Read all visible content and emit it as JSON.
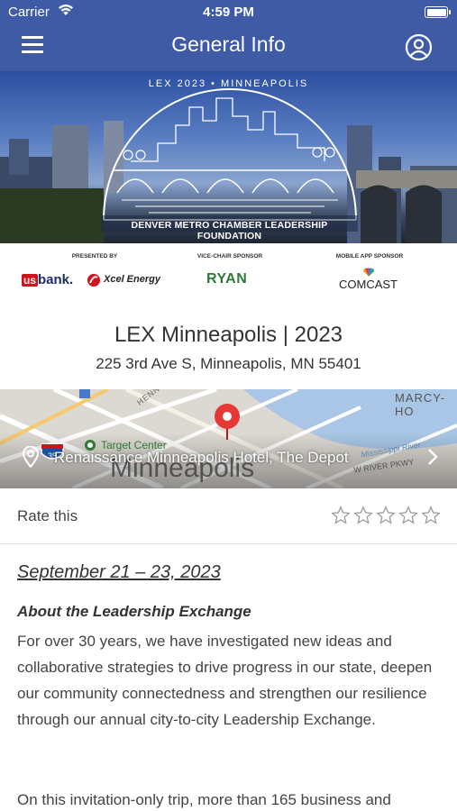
{
  "status_bar": {
    "carrier": "Carrier",
    "time": "4:59 PM"
  },
  "nav": {
    "title": "General Info"
  },
  "banner": {
    "arc_text": "LEX 2023 • MINNEAPOLIS",
    "caption": "DENVER METRO CHAMBER LEADERSHIP FOUNDATION"
  },
  "sponsors": {
    "presented_label": "PRESENTED BY",
    "vice_chair_label": "VICE-CHAIR SPONSOR",
    "mobile_label": "MOBILE APP SPONSOR",
    "usbank_us": "us",
    "usbank_rest": "bank.",
    "xcel": "Xcel Energy",
    "ryan": "RYAN",
    "comcast": "COMCAST"
  },
  "event": {
    "title": "LEX Minneapolis | 2023",
    "address": "225 3rd Ave S, Minneapolis, MN 55401"
  },
  "map": {
    "venue": "Renaissance Minneapolis Hotel, The Depot",
    "city_label": "Minneapolis",
    "target_center": "Target Center",
    "marcy": "MARCY-HO",
    "hennepin": "HENNEPIN",
    "river_pkwy": "W RIVER PKWY",
    "mississippi": "Mississippi River",
    "highway": "35"
  },
  "rating": {
    "label": "Rate this",
    "value": 0,
    "max": 5
  },
  "description": {
    "dates": "September 21 – 23, 2023",
    "about_heading": "About the Leadership Exchange",
    "about_body": "For over 30 years, we have investigated new ideas and collaborative strategies to drive progress in our state, deepen our community connectedness and strengthen our resilience through our annual city-to-city Leadership Exchange.",
    "second_para": "On this invitation-only trip, more than 165 business and"
  },
  "colors": {
    "nav_bg": "#3f5ba6",
    "marker": "#e53935",
    "ryan_green": "#2d7a3b"
  }
}
